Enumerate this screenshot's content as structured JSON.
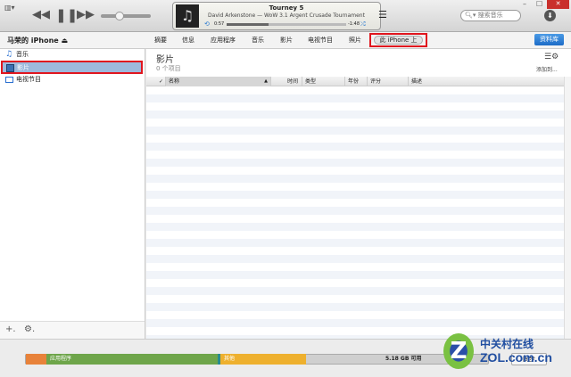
{
  "player": {
    "title": "Tourney 5",
    "subtitle": "David Arkenstone — WoW 3.1 Argent Crusade Tournament",
    "elapsed": "0:57",
    "remaining": "-1:48",
    "progress": 0.35,
    "volume": 0.35
  },
  "search": {
    "placeholder": "搜索音乐"
  },
  "device": {
    "name": "马荣的 iPhone ⏏"
  },
  "tabs": [
    "摘要",
    "信息",
    "应用程序",
    "音乐",
    "影片",
    "电视节目",
    "照片",
    "此 iPhone 上"
  ],
  "library_button": "资料库",
  "sidebar": {
    "items": [
      {
        "label": "音乐"
      },
      {
        "label": "影片"
      },
      {
        "label": "电视节目"
      }
    ]
  },
  "main": {
    "title": "影片",
    "count": "0 个项目",
    "add_to": "添加到..."
  },
  "columns": [
    "✓",
    "名称",
    "时间",
    "类型",
    "年份",
    "评分",
    "描述"
  ],
  "storage": {
    "apps": "应用程序",
    "other": "其他",
    "free": "5.18 GB 可用",
    "sync": "同步"
  },
  "watermark": {
    "cn": "中关村在线",
    "en": "ZOL.com.cn"
  }
}
